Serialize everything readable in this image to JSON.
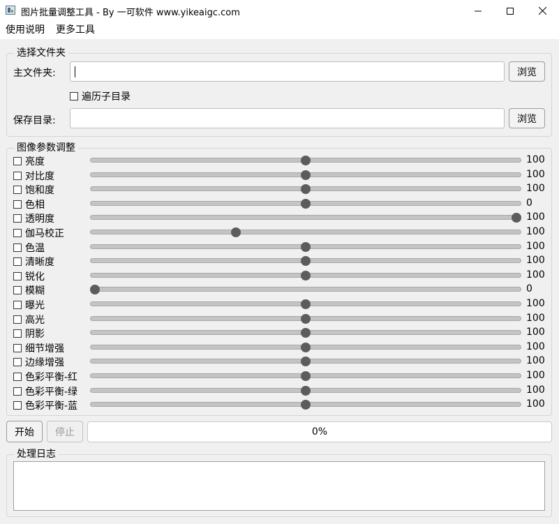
{
  "window": {
    "title": "图片批量调整工具 - By 一可软件 www.yikeaigc.com",
    "minimize_icon": "minimize-icon",
    "maximize_icon": "maximize-icon",
    "close_icon": "close-icon"
  },
  "menu": {
    "items": [
      "使用说明",
      "更多工具"
    ]
  },
  "folder_group": {
    "title": "选择文件夹",
    "main_folder_label": "主文件夹:",
    "main_folder_value": "",
    "browse_label": "浏览",
    "recursive_label": "遍历子目录",
    "recursive_checked": false,
    "save_dir_label": "保存目录:",
    "save_dir_value": "",
    "browse2_label": "浏览"
  },
  "params_group": {
    "title": "图像参数调整",
    "sliders": [
      {
        "label": "亮度",
        "value": "100",
        "position": 0.5,
        "checked": false
      },
      {
        "label": "对比度",
        "value": "100",
        "position": 0.5,
        "checked": false
      },
      {
        "label": "饱和度",
        "value": "100",
        "position": 0.5,
        "checked": false
      },
      {
        "label": "色相",
        "value": "0",
        "position": 0.5,
        "checked": false
      },
      {
        "label": "透明度",
        "value": "100",
        "position": 1.0,
        "checked": false
      },
      {
        "label": "伽马校正",
        "value": "100",
        "position": 0.335,
        "checked": false
      },
      {
        "label": "色温",
        "value": "100",
        "position": 0.5,
        "checked": false
      },
      {
        "label": "清晰度",
        "value": "100",
        "position": 0.5,
        "checked": false
      },
      {
        "label": "锐化",
        "value": "100",
        "position": 0.5,
        "checked": false
      },
      {
        "label": "模糊",
        "value": "0",
        "position": 0.0,
        "checked": false
      },
      {
        "label": "曝光",
        "value": "100",
        "position": 0.5,
        "checked": false
      },
      {
        "label": "高光",
        "value": "100",
        "position": 0.5,
        "checked": false
      },
      {
        "label": "阴影",
        "value": "100",
        "position": 0.5,
        "checked": false
      },
      {
        "label": "细节增强",
        "value": "100",
        "position": 0.5,
        "checked": false
      },
      {
        "label": "边缘增强",
        "value": "100",
        "position": 0.5,
        "checked": false
      },
      {
        "label": "色彩平衡-红",
        "value": "100",
        "position": 0.5,
        "checked": false
      },
      {
        "label": "色彩平衡-绿",
        "value": "100",
        "position": 0.5,
        "checked": false
      },
      {
        "label": "色彩平衡-蓝",
        "value": "100",
        "position": 0.5,
        "checked": false
      }
    ]
  },
  "controls": {
    "start_label": "开始",
    "stop_label": "停止",
    "stop_enabled": false,
    "progress_text": "0%",
    "progress_value": 0
  },
  "log_group": {
    "title": "处理日志",
    "content": ""
  },
  "colors": {
    "background": "#f0f0f0",
    "thumb": "#5c5c5c",
    "track": "#c4c4c4"
  }
}
